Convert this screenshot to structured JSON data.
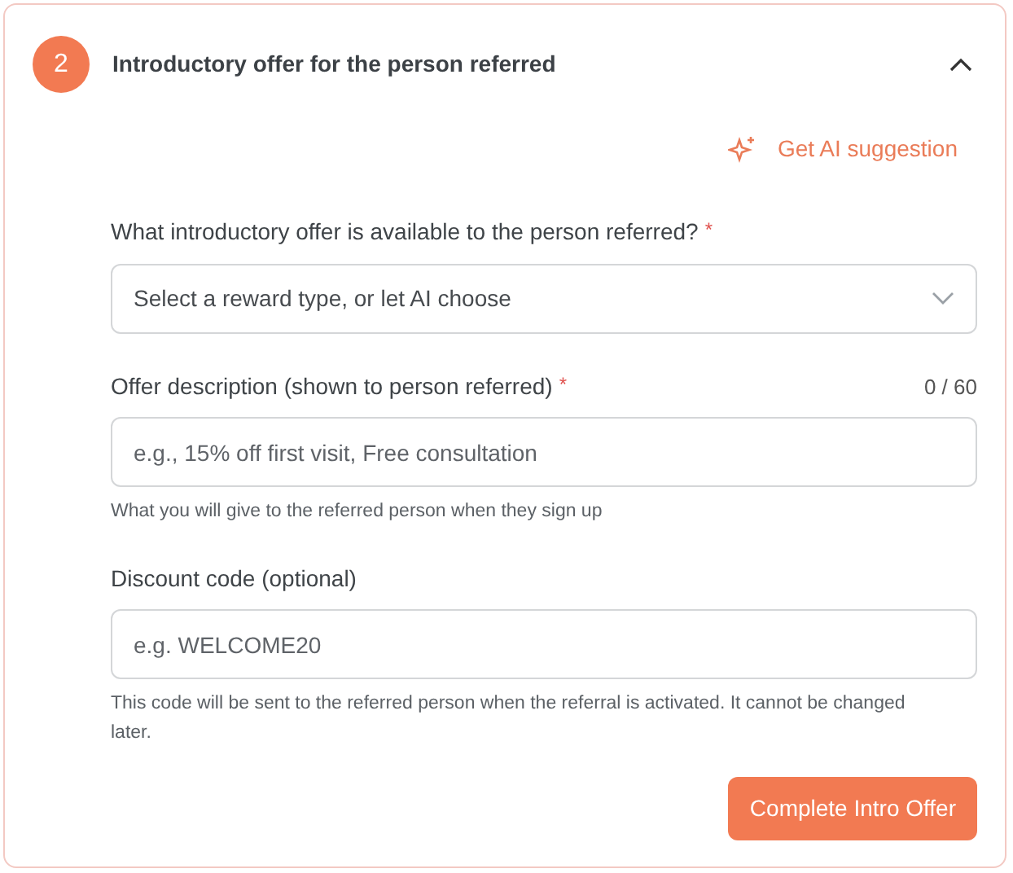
{
  "section": {
    "step": "2",
    "title": "Introductory offer for the person referred",
    "expanded": true
  },
  "ai_button": {
    "label": "Get AI suggestion"
  },
  "fields": [
    {
      "kind": "select",
      "label": "What introductory offer is available to the person referred?",
      "required_mark": "*",
      "placeholder": "Select a reward type, or let AI choose"
    },
    {
      "kind": "input",
      "label": "Offer description (shown to person referred)",
      "required_mark": "*",
      "counter": "0 / 60",
      "placeholder": "e.g., 15% off first visit, Free consultation",
      "hint": "What you will give to the referred person when they sign up"
    },
    {
      "kind": "input",
      "label": "Discount code (optional)",
      "placeholder": "e.g. WELCOME20",
      "hint": "This code will be sent to the referred person when the referral is activated. It cannot be changed later."
    }
  ],
  "submit_button": {
    "label": "Complete Intro Offer"
  }
}
